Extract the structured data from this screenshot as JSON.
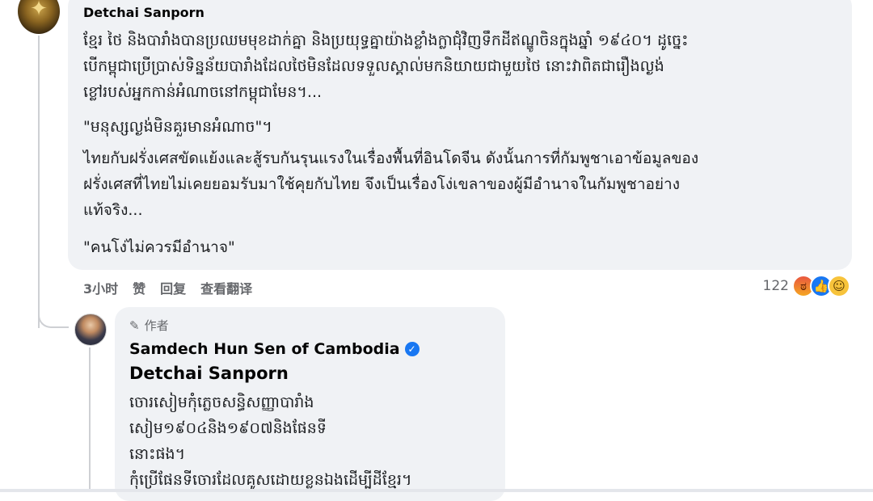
{
  "comment": {
    "author": "Detchai Sanporn",
    "paragraphs": [
      "ខ្មែរ ថៃ និងបារាំងបានប្រឈមមុខដាក់គ្នា និងប្រយុទ្ធគ្នាយ៉ាងខ្លាំងក្លាជុំវិញទឹកដីឥណ្ឌូចិនក្នុងឆ្នាំ ១៩៤០។ ដូច្នេះ\nបើកម្ពុជាប្រើប្រាស់ទិន្នន័យបារាំងដែលថៃមិនដែលទទួលស្គាល់មកនិយាយជាមួយថៃ នោះវាពិតជារឿងល្ងង់\nខ្លៅរបស់អ្នកកាន់អំណាចនៅកម្ពុជាមែន។...",
      "\"មនុស្សល្ងង់មិនគួរមានអំណាច\"។",
      "ไทยกับฝรั่งเศสขัดแย้งและสู้รบกันรุนแรงในเรื่องพื้นที่อินโดจีน ดังนั้นการที่กัมพูชาเอาข้อมูลของ\nฝรั่งเศสที่ไทยไม่เคยยอมรับมาใช้คุยกับไทย จึงเป็นเรื่องโง่เขลาของผู้มีอำนาจในกัมพูชาอย่าง\nแท้จริง...",
      "\"คนโง่ไม่ควรมีอำนาจ\""
    ],
    "actions": {
      "time": "3小时",
      "like": "赞",
      "reply": "回复",
      "translate": "查看翻译"
    },
    "reaction_count": "122",
    "reactions": [
      "angry-icon",
      "like-icon",
      "haha-icon"
    ]
  },
  "reply": {
    "badge": "作者",
    "author": "Samdech Hun Sen of Cambodia",
    "mention": "Detchai Sanporn",
    "text": "ចោរសៀមកុំភ្លេចសន្ធិសញ្ញាបារាំង\nសៀម១៩០៤និង១៩០៧និងផែនទី\nនោះផង។\nកុំប្រើផែនទីចោរដែលគូសដោយខ្លួនឯងដើម្បីដីខ្មែរ។"
  },
  "colors": {
    "bubble": "#f0f2f5",
    "verified": "#1877f2",
    "muted": "#65676b"
  }
}
